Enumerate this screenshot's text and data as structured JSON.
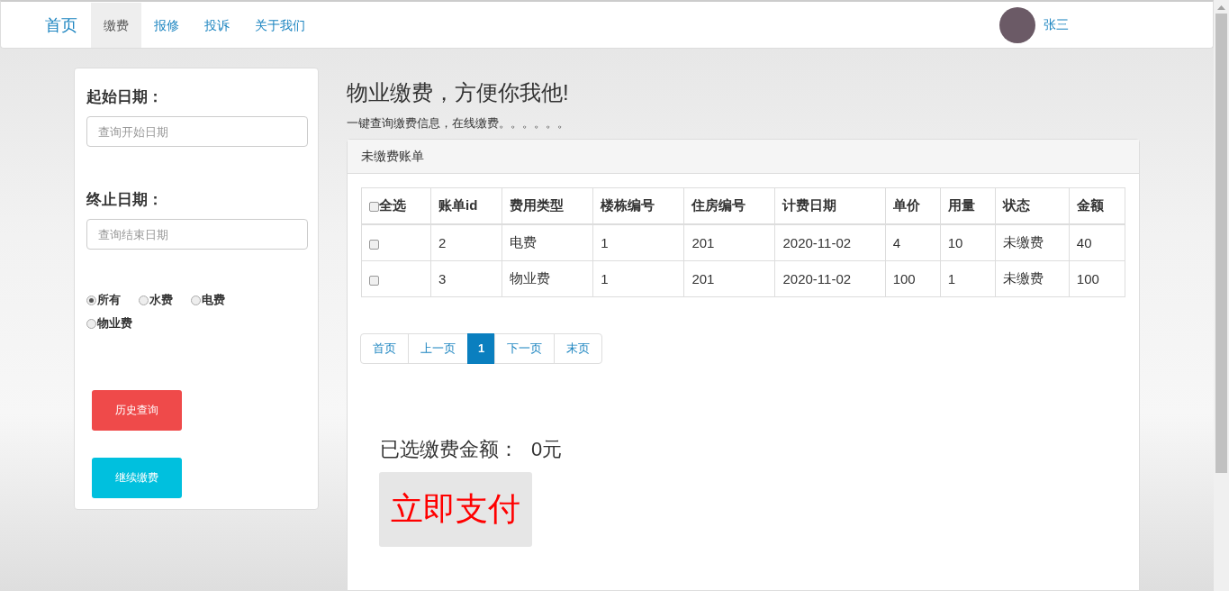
{
  "navbar": {
    "brand": "首页",
    "items": [
      {
        "label": "缴费",
        "selected": true
      },
      {
        "label": "报修",
        "selected": false
      },
      {
        "label": "投诉",
        "selected": false
      },
      {
        "label": "关于我们",
        "selected": false
      }
    ],
    "user": {
      "name": "张三"
    }
  },
  "filter": {
    "start_label": "起始日期：",
    "start_placeholder": "查询开始日期",
    "end_label": "终止日期：",
    "end_placeholder": "查询结束日期",
    "options": [
      {
        "label": "所有",
        "selected": true
      },
      {
        "label": "水费",
        "selected": false
      },
      {
        "label": "电费",
        "selected": false
      },
      {
        "label": "物业费",
        "selected": false
      }
    ],
    "buttons": [
      {
        "label": "历史查询",
        "kind": "danger"
      },
      {
        "label": "继续缴费",
        "kind": "info"
      }
    ]
  },
  "header": {
    "title": "物业缴费，方便你我他!",
    "subtitle": "一键查询缴费信息，在线缴费。。。。。。"
  },
  "bills": {
    "heading": "未缴费账单",
    "select_all": {
      "label": "全选",
      "checked": false
    },
    "columns": [
      "账单id",
      "费用类型",
      "楼栋编号",
      "住房编号",
      "计费日期",
      "单价",
      "用量",
      "状态",
      "金额"
    ],
    "rows": [
      {
        "checked": false,
        "cells": [
          "2",
          "电费",
          "1",
          "201",
          "2020-11-02",
          "4",
          "10",
          "未缴费",
          "40"
        ]
      },
      {
        "checked": false,
        "cells": [
          "3",
          "物业费",
          "1",
          "201",
          "2020-11-02",
          "100",
          "1",
          "未缴费",
          "100"
        ]
      }
    ]
  },
  "pagination": [
    {
      "label": "首页",
      "selected": false
    },
    {
      "label": "上一页",
      "selected": false
    },
    {
      "label": "1",
      "selected": true
    },
    {
      "label": "下一页",
      "selected": false
    },
    {
      "label": "末页",
      "selected": false
    }
  ],
  "total": {
    "label": "已选缴费金额：",
    "value": "0元"
  },
  "pay_button": "立即支付"
}
